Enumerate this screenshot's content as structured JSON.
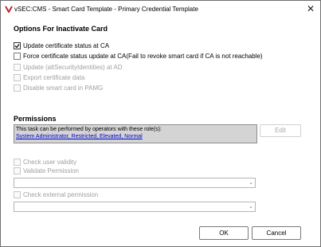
{
  "window": {
    "title": "vSEC:CMS - Smart Card Template - Primary Credential Template",
    "icon": "vsec-logo-icon",
    "close_label": "✕"
  },
  "inactivate": {
    "title": "Options For Inactivate Card",
    "options": [
      {
        "label": "Update certificate status at CA",
        "checked": true,
        "enabled": true
      },
      {
        "label": "Force certificate status update at CA(Fail to revoke smart card if CA is not reachable)",
        "checked": false,
        "enabled": true
      },
      {
        "label": "Update (altSecurityIdentities) at AD",
        "checked": false,
        "enabled": false
      },
      {
        "label": "Export certificate data",
        "checked": false,
        "enabled": false
      },
      {
        "label": "Disable smart card in PAMG",
        "checked": false,
        "enabled": false
      }
    ]
  },
  "permissions": {
    "title": "Permissions",
    "roles_intro": "This task can be performed by operators with these role(s):",
    "roles_link": "System Administrator, Restricted, Elevated, Normal",
    "edit_label": "Edit",
    "check_user_validity": "Check user validity",
    "validate_permission": "Validate Permission",
    "check_external_permission": "Check external permission",
    "dropdown_arrow": "⌄"
  },
  "buttons": {
    "ok_label": "OK",
    "cancel_label": "Cancel"
  }
}
